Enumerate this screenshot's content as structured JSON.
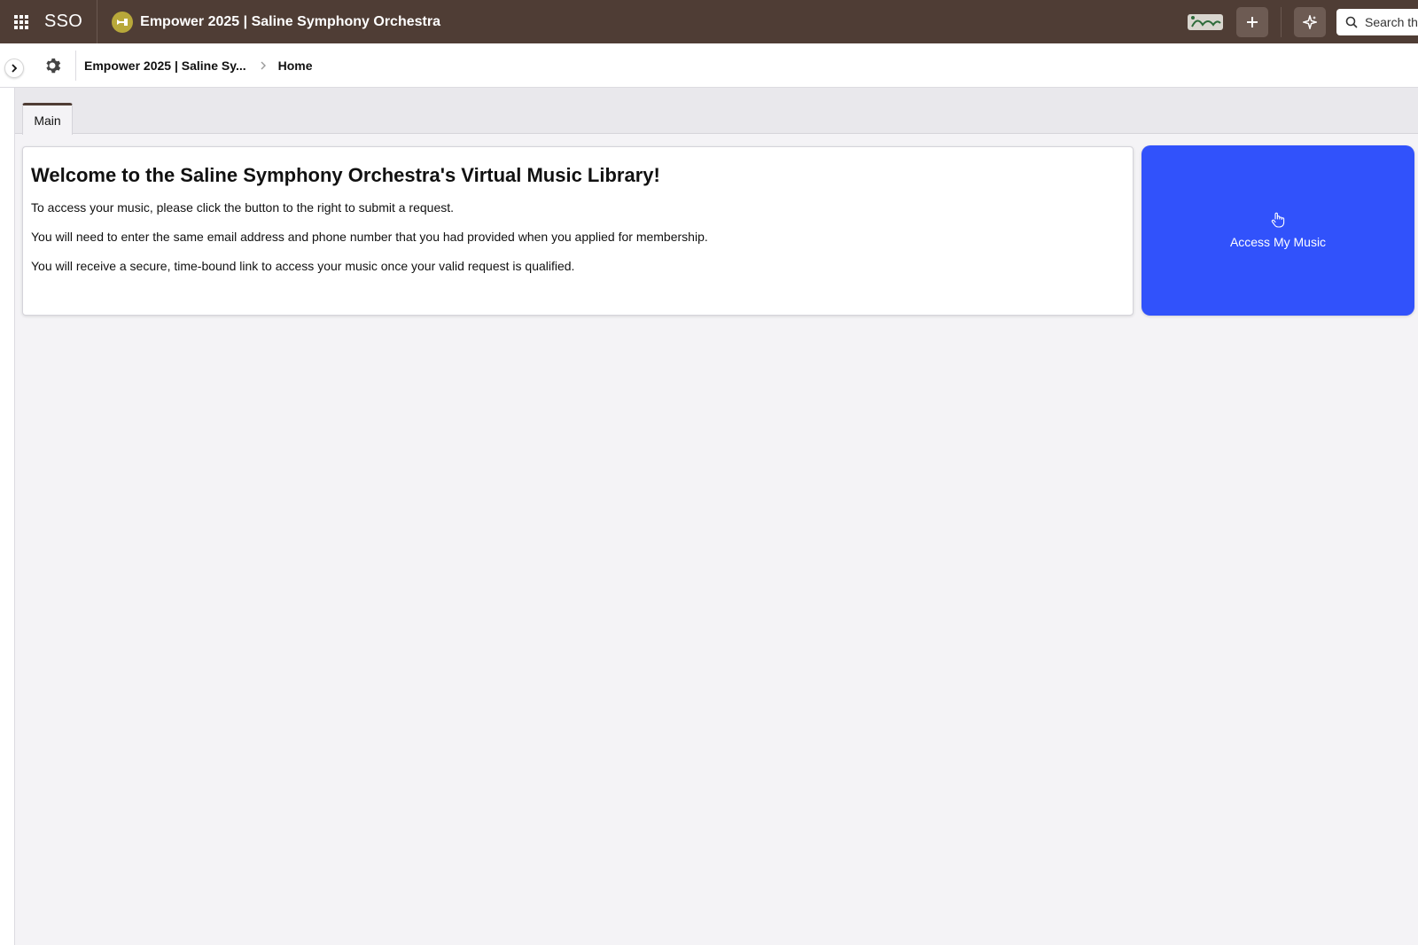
{
  "topbar": {
    "app_name": "SSO",
    "app_title": "Empower 2025 | Saline Symphony Orchestra",
    "search_placeholder": "Search th",
    "icons": {
      "launcher": "grid-icon",
      "add": "plus-icon",
      "assistant": "sparkle-icon",
      "search": "search-icon"
    }
  },
  "subbar": {
    "breadcrumb": [
      "Empower 2025 | Saline Sy...",
      "Home"
    ]
  },
  "tabs": [
    {
      "label": "Main",
      "active": true
    }
  ],
  "welcome": {
    "heading": "Welcome to the Saline Symphony Orchestra's Virtual Music Library!",
    "paragraphs": [
      "To access your music, please click the button to the right to submit a request.",
      "You will need to enter the same email address and phone number that you had provided when you applied for membership.",
      "You will receive a secure, time-bound link to access your music once your valid request is qualified."
    ]
  },
  "access_button": {
    "label": "Access My Music"
  },
  "colors": {
    "topbar": "#4f3d35",
    "accent_button": "#3152fb",
    "background": "#f4f3f6"
  }
}
